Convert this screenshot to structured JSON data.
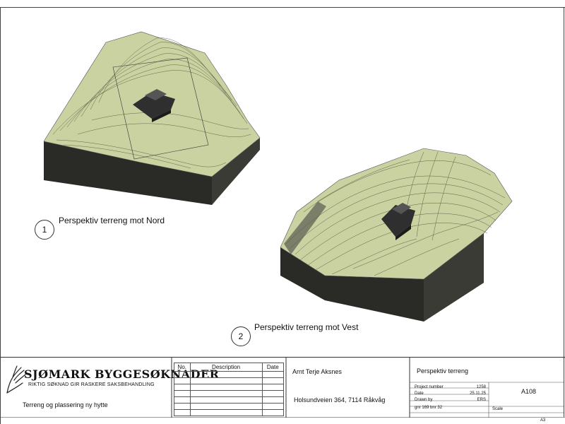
{
  "views": [
    {
      "number": "1",
      "label": "Perspektiv terreng mot Nord"
    },
    {
      "number": "2",
      "label": "Perspektiv terreng mot Vest"
    }
  ],
  "titleblock": {
    "company": "SJØMARK BYGGESØKNADER",
    "slogan": "RIKTIG SØKNAD GIR RASKERE SAKSBEHANDLING",
    "project_description": "Terreng og plassering ny hytte",
    "revision_headers": {
      "no": "No.",
      "description": "Description",
      "date": "Date"
    },
    "client_name": "Arnt Terje Aksnes",
    "client_address": "Holsundveien 364, 7114 Råkvåg",
    "sheet_title": "Perspektiv terreng",
    "fields": [
      {
        "label": "Project number",
        "value": "1258"
      },
      {
        "label": "Date",
        "value": "25.11.25"
      },
      {
        "label": "Drawn by",
        "value": "ERS"
      },
      {
        "label": "gnr 169 bnr 32",
        "value": ""
      }
    ],
    "sheet_number": "A108",
    "scale_label": "Scale",
    "paper_size": "A3"
  },
  "colors": {
    "terrain_top": "#c9d2a0",
    "terrain_contour": "#4a4a3a",
    "terrain_side": "#2a2a26",
    "house": "#2f2f2f"
  }
}
